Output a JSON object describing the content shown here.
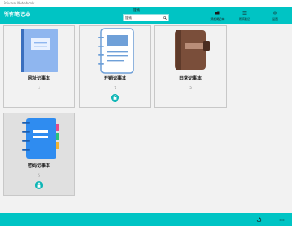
{
  "window": {
    "title": "Private Notebook"
  },
  "header": {
    "title": "所有笔记本",
    "search_label": "搜索",
    "search_value": "搜索",
    "buttons": [
      {
        "label": "添加笔记本",
        "icon": "folder-plus-icon"
      },
      {
        "label": "所有笔记",
        "icon": "list-icon"
      },
      {
        "label": "设置",
        "icon": "gear-icon"
      }
    ]
  },
  "notebooks": [
    {
      "name": "网址记事本",
      "count": "4",
      "locked": false,
      "icon": "blue-book-icon"
    },
    {
      "name": "开销记事本",
      "count": "7",
      "locked": true,
      "icon": "spiral-notepad-icon"
    },
    {
      "name": "日常记事本",
      "count": "3",
      "locked": false,
      "icon": "leather-journal-icon"
    },
    {
      "name": "密码记事本",
      "count": "5",
      "locked": true,
      "icon": "tabbed-notebook-icon"
    }
  ],
  "footer": {
    "icons": [
      "sync-icon",
      "more-icon"
    ]
  },
  "colors": {
    "accent": "#00c4c4",
    "lock_badge": "#10b6b6"
  }
}
